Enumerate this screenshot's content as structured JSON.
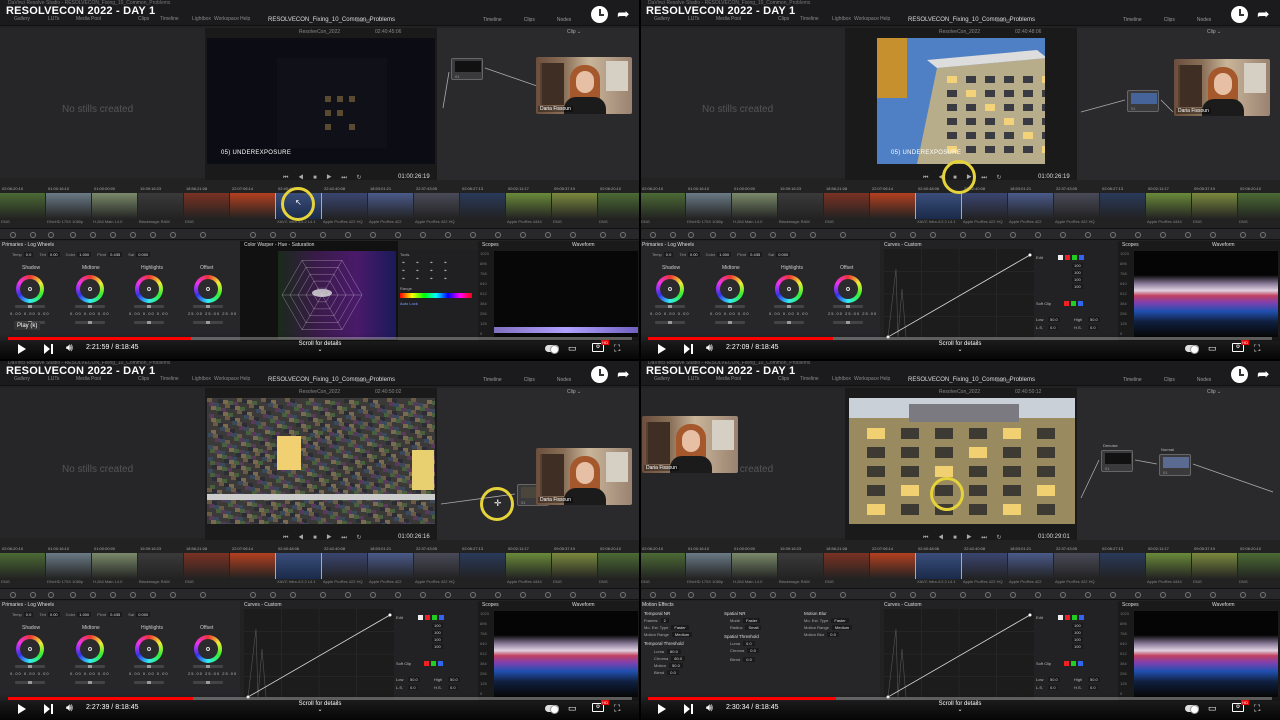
{
  "quadrants": [
    {
      "video_title": "RESOLVECON 2022 - DAY 1",
      "window_title": "DaVinci Resolve Studio - RESOLVECON_Fixing_10_Common_Problems",
      "page_tabs": [
        "Gallery",
        "LUTs",
        "Media Pool",
        "Clips",
        "Timeline",
        "Lightbox",
        "Workspace",
        "Help"
      ],
      "project": "RESOLVECON_Fixing_10_Common_Problems",
      "edited": "Edited",
      "top_buttons": [
        "Timeline",
        "Clips",
        "Nodes"
      ],
      "gallery_text": "No stills created",
      "viewer_name": "ResolveCon_2022",
      "viewer_tc": "02:40:45:06",
      "frame_label": "05) UNDEREXPOSURE",
      "timecode": "01:00:26:19",
      "webcam_name": "Daria Fissoun",
      "panel_title": "Primaries - Log Wheels",
      "mid_title": "Color Warper - Hue - Saturation",
      "time": "2:21:59 / 8:18:45",
      "tooltip": "Play (k)",
      "progress": 0.293
    },
    {
      "video_title": "RESOLVECON 2022 - DAY 1",
      "window_title": "DaVinci Resolve Studio - RESOLVECON_Fixing_10_Common_Problems",
      "page_tabs": [
        "Gallery",
        "LUTs",
        "Media Pool",
        "Clips",
        "Timeline",
        "Lightbox",
        "Workspace",
        "Help"
      ],
      "project": "RESOLVECON_Fixing_10_Common_Problems",
      "edited": "Edited",
      "top_buttons": [
        "Timeline",
        "Clips",
        "Nodes"
      ],
      "gallery_text": "No stills created",
      "viewer_name": "ResolveCon_2022",
      "viewer_tc": "02:40:48:06",
      "frame_label": "05) UNDEREXPOSURE",
      "timecode": "01:00:26:19",
      "webcam_name": "Daria Fissoun",
      "panel_title": "Primaries - Log Wheels",
      "mid_title": "Curves - Custom",
      "time": "2:27:09 / 8:18:45",
      "tooltip": "",
      "progress": 0.296
    },
    {
      "video_title": "RESOLVECON 2022 - DAY 1",
      "window_title": "DaVinci Resolve Studio - RESOLVECON_Fixing_10_Common_Problems",
      "page_tabs": [
        "Gallery",
        "LUTs",
        "Media Pool",
        "Clips",
        "Timeline",
        "Lightbox",
        "Workspace",
        "Help"
      ],
      "project": "RESOLVECON_Fixing_10_Common_Problems",
      "edited": "Edited",
      "top_buttons": [
        "Timeline",
        "Clips",
        "Nodes"
      ],
      "gallery_text": "No stills created",
      "viewer_name": "ResolveCon_2022",
      "viewer_tc": "02:40:50:02",
      "frame_label": "",
      "timecode": "01:00:26:16",
      "webcam_name": "Daria Fissoun",
      "panel_title": "Primaries - Log Wheels",
      "mid_title": "Curves - Custom",
      "time": "2:27:39 / 8:18:45",
      "tooltip": "",
      "progress": 0.297
    },
    {
      "video_title": "RESOLVECON 2022 - DAY 1",
      "window_title": "DaVinci Resolve Studio - RESOLVECON_Fixing_10_Common_Problems",
      "page_tabs": [
        "Gallery",
        "LUTs",
        "Media Pool",
        "Clips",
        "Timeline",
        "Lightbox",
        "Workspace",
        "Help"
      ],
      "project": "RESOLVECON_Fixing_10_Common_Problems",
      "edited": "Edited",
      "top_buttons": [
        "Timeline",
        "Clips",
        "Nodes"
      ],
      "gallery_text": "No stills created",
      "viewer_name": "ResolveCon_2022",
      "viewer_tc": "02:40:50:12",
      "frame_label": "",
      "timecode": "01:00:29:01",
      "webcam_name": "Daria Fissoun",
      "panel_title": "Motion Effects",
      "mid_title": "Curves - Custom",
      "time": "2:30:34 / 8:18:45",
      "tooltip": "",
      "progress": 0.302
    }
  ],
  "clip_timecodes": [
    "02:06:20:10",
    "01:00:16:10",
    "01:00:00:00",
    "19:39:16:23",
    "18:56:21:08",
    "22:07:06:14",
    "02:40:48:06",
    "22:42:40:08",
    "18:53:01:21",
    "22:37:43:05",
    "02:06:27:13",
    "00:02:11:17",
    "09:05:37:19"
  ],
  "clip_codecs": [
    "DNG",
    "DNxHD 175X 1080p",
    "H.264 Main L4.0",
    "Blackmagic RAW",
    "DNG",
    "",
    "XAVC Intra 4:2:2 L4.1",
    "Apple ProRes 422 HQ",
    "Apple ProRes 422",
    "Apple ProRes 422 HQ",
    "",
    "Apple ProRes 4444",
    "DNG"
  ],
  "wheels": [
    "Shadow",
    "Midtone",
    "Highlights",
    "Offset"
  ],
  "params": {
    "temp_label": "Temp",
    "temp": "0.0",
    "tint_label": "Tint",
    "tint": "0.00",
    "color_label": "Color",
    "color": "1.000",
    "pivot_label": "Pivot",
    "pivot": "0.435",
    "sat_label": "Sat",
    "sat": "0.000"
  },
  "scopes": {
    "title": "Scopes",
    "mode": "Waveform",
    "ticks": [
      "1023",
      "896",
      "768",
      "640",
      "512",
      "384",
      "256",
      "128",
      "0"
    ]
  },
  "curves_edit": {
    "edit": "Edit",
    "soft_clip": "Soft Clip",
    "values": [
      "100",
      "100",
      "100",
      "100"
    ],
    "low": "Low",
    "high": "High",
    "ls": "L.S.",
    "hs": "H.S.",
    "low_val": "50.0",
    "high_val": "50.0",
    "ls_val": "0.0",
    "hs_val": "0.0"
  },
  "tools": {
    "label": "Tools",
    "range": "Range",
    "auto_lock": "Auto Lock"
  },
  "nodes_q3": [
    "Denoise",
    "Normal"
  ],
  "motion": {
    "temporal_nr": "Temporal NR",
    "frames": "Frames",
    "frames_val": "2",
    "mo_est": "Mo. Est. Type",
    "mo_est_val": "Faster",
    "motion_range": "Motion Range",
    "motion_range_val": "Medium",
    "temporal_threshold": "Temporal Threshold",
    "luma": "Luma",
    "luma_val": "60.0",
    "chroma": "Chroma",
    "chroma_val": "60.0",
    "motion_lab": "Motion",
    "motion_val": "50.0",
    "blend": "Blend",
    "blend_val": "0.0",
    "spatial_nr": "Spatial NR",
    "mode": "Mode",
    "mode_val": "Faster",
    "radius": "Radius",
    "radius_val": "Small",
    "spatial_threshold": "Spatial Threshold",
    "s_luma_val": "0.0",
    "s_chroma_val": "0.0",
    "s_blend_val": "0.0",
    "motion_blur": "Motion Blur",
    "mb_est": "Mo. Est. Type",
    "mb_est_val": "Faster",
    "mb_range": "Motion Range",
    "mb_range_val": "Medium",
    "mb_blur": "Motion Blur",
    "mb_blur_val": "0.0"
  },
  "youtube": {
    "scroll_text": "Scroll for details",
    "scroll_arrow": "⌄"
  },
  "icons": [
    "clock-icon",
    "share-icon",
    "play-icon",
    "next-icon",
    "volume-icon",
    "autoplay-toggle",
    "captions-icon",
    "settings-icon",
    "fullscreen-icon"
  ],
  "colors": {
    "highlight_ring": "#e6d33a",
    "progress": "#ff0000",
    "ui_bg": "#222222"
  }
}
